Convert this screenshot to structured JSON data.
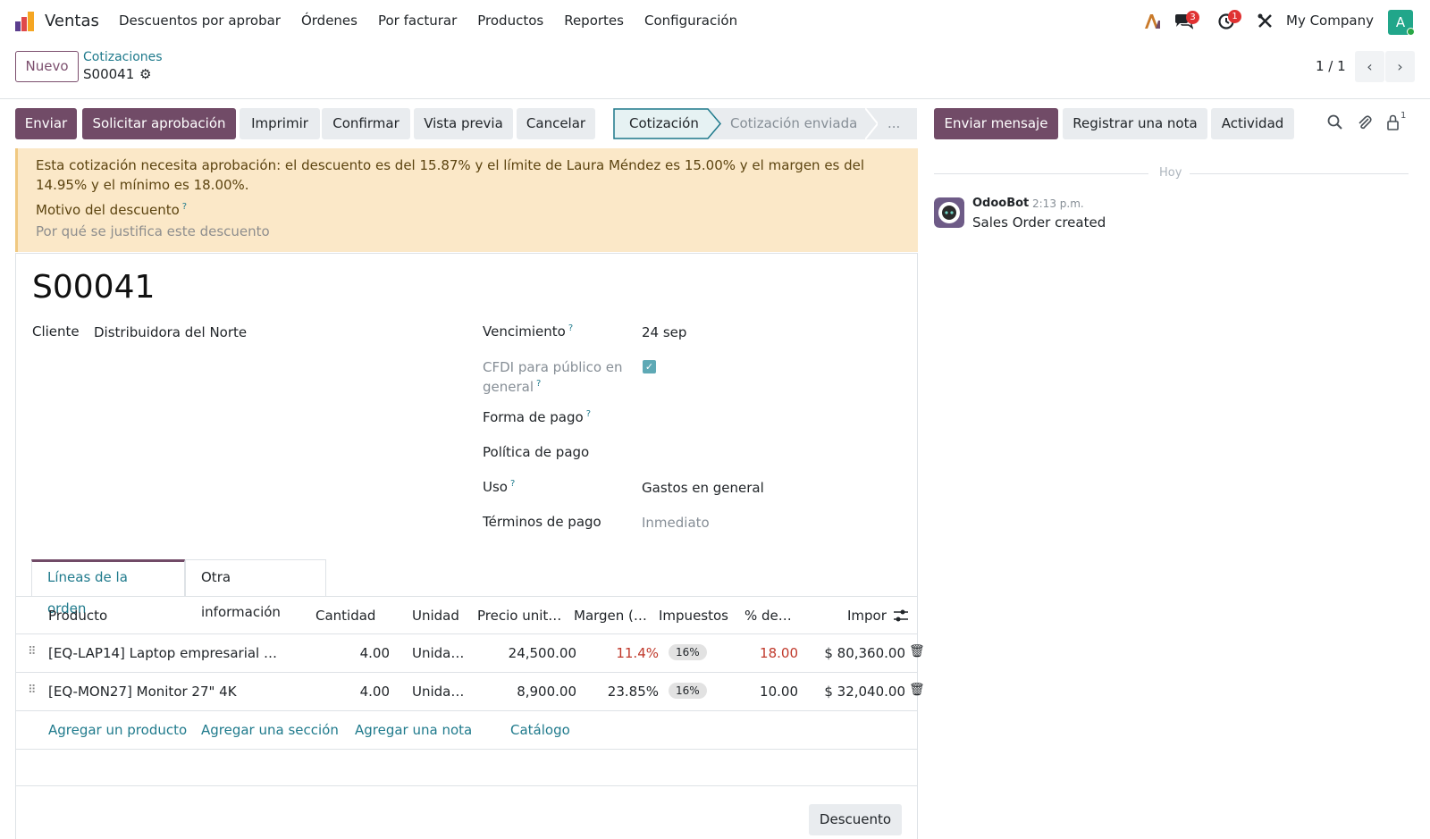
{
  "navbar": {
    "app_name": "Ventas",
    "menu": [
      "Descuentos por aprobar",
      "Órdenes",
      "Por facturar",
      "Productos",
      "Reportes",
      "Configuración"
    ],
    "messages_badge": "3",
    "activities_badge": "1",
    "company": "My Company",
    "avatar_letter": "A"
  },
  "control": {
    "new_button": "Nuevo",
    "breadcrumb_parent": "Cotizaciones",
    "breadcrumb_current": "S00041",
    "pager": "1 / 1"
  },
  "actions": {
    "send": "Enviar",
    "request_approval": "Solicitar aprobación",
    "print": "Imprimir",
    "confirm": "Confirmar",
    "preview": "Vista previa",
    "cancel": "Cancelar"
  },
  "stages": {
    "current": "Cotización",
    "next": "Cotización enviada",
    "more": "..."
  },
  "alert": {
    "text": "Esta cotización necesita aprobación: el descuento es del 15.87% y el límite de Laura Méndez es 15.00% y el margen es del 14.95% y el mínimo es 18.00%.",
    "reason_label": "Motivo del descuento",
    "reason_placeholder": "Por qué se justifica este descuento"
  },
  "form": {
    "title": "S00041",
    "customer_label": "Cliente",
    "customer_value": "Distribuidora del Norte",
    "expiration_label": "Vencimiento",
    "expiration_value": "24 sep",
    "cfdi_label_1": "CFDI para público en",
    "cfdi_label_2": "general",
    "payment_way_label": "Forma de pago",
    "payment_policy_label": "Política de pago",
    "usage_label": "Uso",
    "usage_value": "Gastos en general",
    "payment_terms_label": "Términos de pago",
    "payment_terms_placeholder": "Inmediato"
  },
  "tabs": [
    "Líneas de la orden",
    "Otra información"
  ],
  "table": {
    "headers": [
      "Producto",
      "Cantidad",
      "Unidad",
      "Precio unit…",
      "Margen (…",
      "Impuestos",
      "% de…",
      "Impor"
    ],
    "rows": [
      {
        "product": "[EQ-LAP14] Laptop empresarial …",
        "qty": "4.00",
        "unit": "Unida…",
        "price": "24,500.00",
        "margin": "11.4%",
        "tax": "16%",
        "discount": "18.00",
        "amount": "$ 80,360.00"
      },
      {
        "product": "[EQ-MON27] Monitor 27\" 4K",
        "qty": "4.00",
        "unit": "Unida…",
        "price": "8,900.00",
        "margin": "23.85%",
        "tax": "16%",
        "discount": "10.00",
        "amount": "$ 32,040.00"
      }
    ],
    "add_product": "Agregar un producto",
    "add_section": "Agregar una sección",
    "add_note": "Agregar una nota",
    "catalog": "Catálogo"
  },
  "discount_button": "Descuento",
  "chatter": {
    "send_message": "Enviar mensaje",
    "log_note": "Registrar una nota",
    "activity": "Actividad",
    "followers_count": "1",
    "date_separator": "Hoy",
    "message_author": "OdooBot",
    "message_time": "2:13 p.m.",
    "message_body": "Sales Order created"
  },
  "colors": {
    "primary": "#714b67",
    "link": "#1f7a8c",
    "alert_bg": "#fbe8c8",
    "danger_text": "#c0392b"
  }
}
